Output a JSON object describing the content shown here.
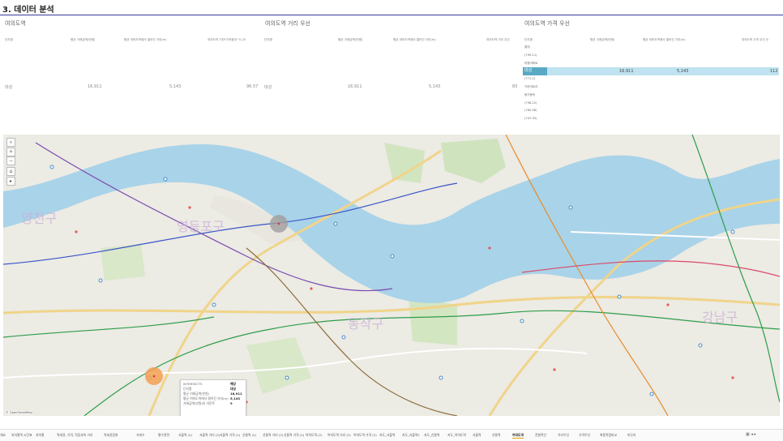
{
  "header": {
    "title": "3. 데이터 분석"
  },
  "sections": {
    "left": {
      "title": "여의도역"
    },
    "middle": {
      "title": "여의도역 거리 우선"
    },
    "right": {
      "title": "여의도역 가격 우선"
    }
  },
  "left_table": {
    "columns": [
      "단지명",
      "평균 거래금액(만원)",
      "평균 여의도역에서 떨어진 거리(m)",
      "여의도역 거리*가격중치^0.25"
    ],
    "row": {
      "name": "대성",
      "price": "16,911",
      "distance": "5,143",
      "score": "96.57"
    }
  },
  "middle_table": {
    "columns": [
      "단지명",
      "평균 거래금액(만원)",
      "평균 여의도역에서 떨어진 거리(m)",
      "여의도역 거리 우선"
    ],
    "row": {
      "name": "대성",
      "price": "16,911",
      "distance": "5,143",
      "score": "83"
    }
  },
  "right_table": {
    "columns": [
      "단지명",
      "평균 거래금액(만원)",
      "평균 여의도역에서 떨어진 거리(m)",
      "여의도역 가격 우선 순"
    ],
    "rows": [
      {
        "name": "롯데",
        "price": "",
        "distance": "",
        "score": ""
      },
      {
        "name": "(799-11)",
        "price": "",
        "distance": "",
        "score": ""
      },
      {
        "name": "미원아파트",
        "price": "",
        "distance": "",
        "score": ""
      },
      {
        "name": "대성",
        "price": "16,911",
        "distance": "5,143",
        "score": "112",
        "selected": true
      },
      {
        "name": "(771-2)",
        "price": "",
        "distance": "",
        "score": ""
      },
      {
        "name": "기라아트리",
        "price": "",
        "distance": "",
        "score": ""
      },
      {
        "name": "동거동속",
        "price": "",
        "distance": "",
        "score": ""
      },
      {
        "name": "(798-22)",
        "price": "",
        "distance": "",
        "score": ""
      },
      {
        "name": "(760-58)",
        "price": "",
        "distance": "",
        "score": ""
      },
      {
        "name": "(747-35)",
        "price": "",
        "distance": "",
        "score": ""
      }
    ]
  },
  "map": {
    "district_labels": [
      "영등포구",
      "동작구",
      "강남구",
      "양천구"
    ],
    "attribution": "© OpenStreetMap",
    "tools": [
      "⌕",
      "+",
      "−",
      "⌂",
      "▸"
    ]
  },
  "tooltip": {
    "rows": [
      {
        "k": "INTERSECTS",
        "v": "해당"
      },
      {
        "k": "단지명",
        "v": "대성"
      },
      {
        "k": "평균 거래금액(만원)",
        "v": "16,911"
      },
      {
        "k": "평균 여의도역에서 떨어진 거리(m)",
        "v": "5,143"
      },
      {
        "k": "거래금액(만원)의 카운트",
        "v": "9"
      }
    ]
  },
  "tabs": [
    "개요",
    "지하철역 시간표",
    "지하철",
    "역세권, 가격, 직장과의 거리",
    "역세권점위",
    "거래수",
    "평수관련",
    "서울역 (2)",
    "서울역 거리 (2)",
    "서울역 가격 (2)",
    "선릉역 (2)",
    "선릉역 거리 (2)",
    "선릉역 가격 (2)",
    "여의도역 (2)",
    "여의도역 거리 (2)",
    "여의도역 가격 (2)",
    "지도_서울역",
    "지도_서울역2",
    "지도_선릉역",
    "지도_여의도역",
    "서울역",
    "선릉역",
    "여의도역",
    "전형적인",
    "거리우선",
    "가격우선",
    "최종적점비교",
    "마무리"
  ],
  "active_tab": "여의도역",
  "colors": {
    "accent": "#3a3a9a",
    "selected_row": "#bfe3f0",
    "river": "#a9d3e8",
    "highlight_circle": "#f4a052"
  }
}
